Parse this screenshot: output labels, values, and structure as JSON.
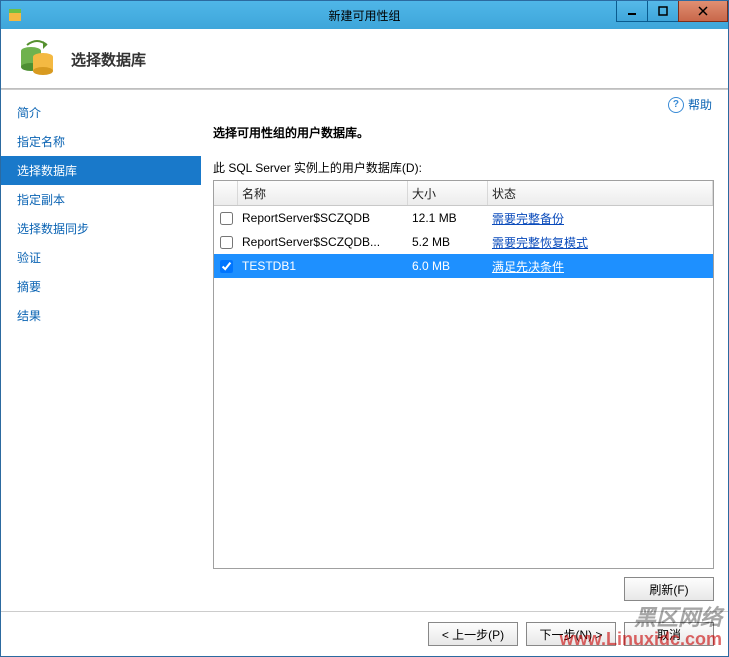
{
  "titlebar": {
    "title": "新建可用性组"
  },
  "header": {
    "page_title": "选择数据库"
  },
  "sidebar": {
    "items": [
      {
        "label": "简介"
      },
      {
        "label": "指定名称"
      },
      {
        "label": "选择数据库"
      },
      {
        "label": "指定副本"
      },
      {
        "label": "选择数据同步"
      },
      {
        "label": "验证"
      },
      {
        "label": "摘要"
      },
      {
        "label": "结果"
      }
    ],
    "selected_index": 2
  },
  "main": {
    "help_label": "帮助",
    "instruction": "选择可用性组的用户数据库。",
    "list_label": "此 SQL Server 实例上的用户数据库(D):",
    "columns": {
      "name": "名称",
      "size": "大小",
      "status": "状态"
    },
    "rows": [
      {
        "checked": false,
        "name": "ReportServer$SCZQDB",
        "size": "12.1 MB",
        "status": "需要完整备份"
      },
      {
        "checked": false,
        "name": "ReportServer$SCZQDB...",
        "size": "5.2 MB",
        "status": "需要完整恢复模式"
      },
      {
        "checked": true,
        "name": "TESTDB1",
        "size": "6.0 MB",
        "status": "满足先决条件"
      }
    ],
    "selected_row_index": 2,
    "refresh_label": "刷新(F)"
  },
  "footer": {
    "prev": "< 上一步(P)",
    "next": "下一步(N) >",
    "cancel": "取消"
  },
  "watermark": {
    "line1": "黑区网络",
    "line2": "www.Linuxidc.com"
  }
}
